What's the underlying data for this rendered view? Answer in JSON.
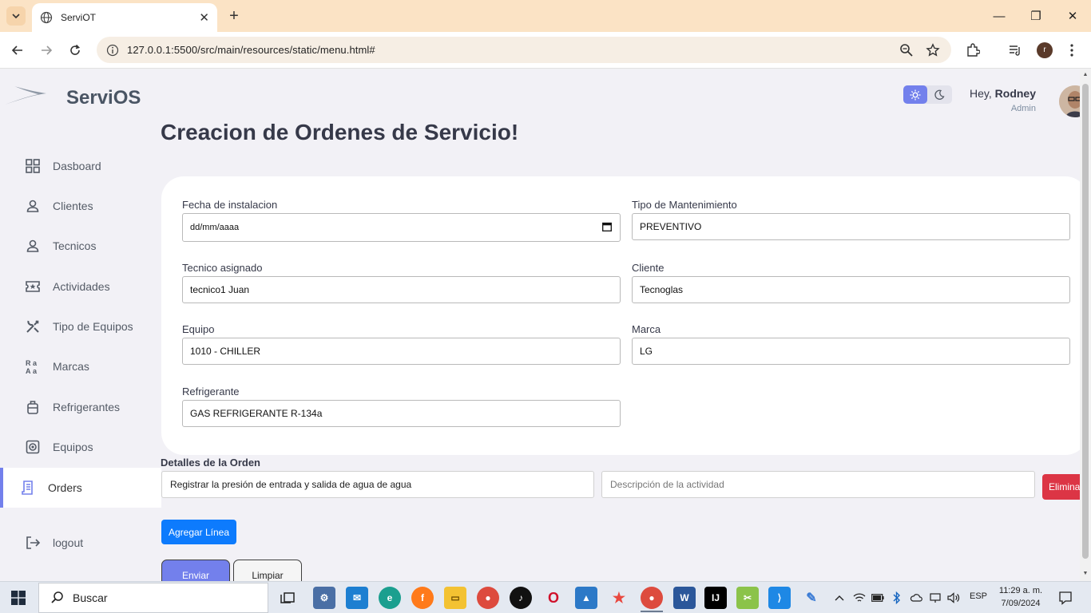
{
  "browser": {
    "tab_title": "ServiOT",
    "url": "127.0.0.1:5500/src/main/resources/static/menu.html#"
  },
  "app": {
    "brand_prefix": "Servi",
    "brand_suffix": "OS",
    "greeting_prefix": "Hey, ",
    "user_name": "Rodney",
    "user_role": "Admin",
    "accent_color": "#7380ec"
  },
  "sidebar": {
    "items": [
      {
        "label": "Dasboard",
        "icon": "grid-icon"
      },
      {
        "label": "Clientes",
        "icon": "person-icon"
      },
      {
        "label": "Tecnicos",
        "icon": "person-icon"
      },
      {
        "label": "Actividades",
        "icon": "ticket-icon"
      },
      {
        "label": "Tipo de Equipos",
        "icon": "tools-icon"
      },
      {
        "label": "Marcas",
        "icon": "translate-icon"
      },
      {
        "label": "Refrigerantes",
        "icon": "luggage-icon"
      },
      {
        "label": "Equipos",
        "icon": "device-icon"
      },
      {
        "label": "Orders",
        "icon": "receipt-icon",
        "active": true
      },
      {
        "label": "logout",
        "icon": "logout-icon"
      }
    ]
  },
  "main": {
    "title": "Creacion de Ordenes de Servicio!",
    "form": {
      "fecha_label": "Fecha de instalacion",
      "fecha_placeholder": "dd/mm/aaaa",
      "tipo_label": "Tipo de Mantenimiento",
      "tipo_value": "PREVENTIVO",
      "tecnico_label": "Tecnico asignado",
      "tecnico_value": "tecnico1 Juan",
      "cliente_label": "Cliente",
      "cliente_value": "Tecnoglas",
      "equipo_label": "Equipo",
      "equipo_value": "1010 - CHILLER",
      "marca_label": "Marca",
      "marca_value": "LG",
      "refrigerante_label": "Refrigerante",
      "refrigerante_value": "GAS REFRIGERANTE R-134a"
    },
    "details": {
      "title": "Detalles de la Orden",
      "line_activity": "Registrar la presión de entrada y salida de agua de agua",
      "line_description_placeholder": "Descripción de la actividad",
      "delete_label": "Eliminar",
      "add_line_label": "Agregar Línea",
      "send_label": "Enviar",
      "clear_label": "Limpiar"
    }
  },
  "taskbar": {
    "search_placeholder": "Buscar",
    "language": "ESP",
    "time": "11:29 a. m.",
    "date": "7/09/2024"
  }
}
